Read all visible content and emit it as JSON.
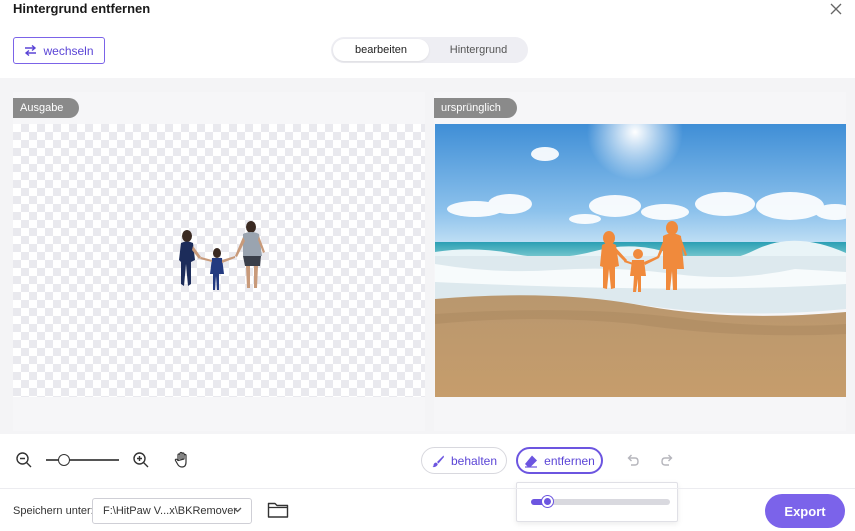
{
  "window": {
    "title": "Hintergrund entfernen"
  },
  "toolbar": {
    "switch_label": "wechseln",
    "tabs": [
      {
        "label": "bearbeiten",
        "active": true
      },
      {
        "label": "Hintergrund",
        "active": false
      }
    ]
  },
  "panels": {
    "output_tag": "Ausgabe",
    "original_tag": "ursprünglich"
  },
  "zoom": {
    "level_fraction": 0.25
  },
  "brush": {
    "keep_label": "behalten",
    "remove_label": "entfernen",
    "active_mode": "entfernen",
    "size_fraction": 0.12
  },
  "footer": {
    "save_label": "Speichern unter:",
    "path_value": "F:\\HitPaw V...x\\BKRemover",
    "export_label": "Export"
  },
  "colors": {
    "accent": "#7b63ea",
    "subject_mask": "#f08a3c"
  }
}
